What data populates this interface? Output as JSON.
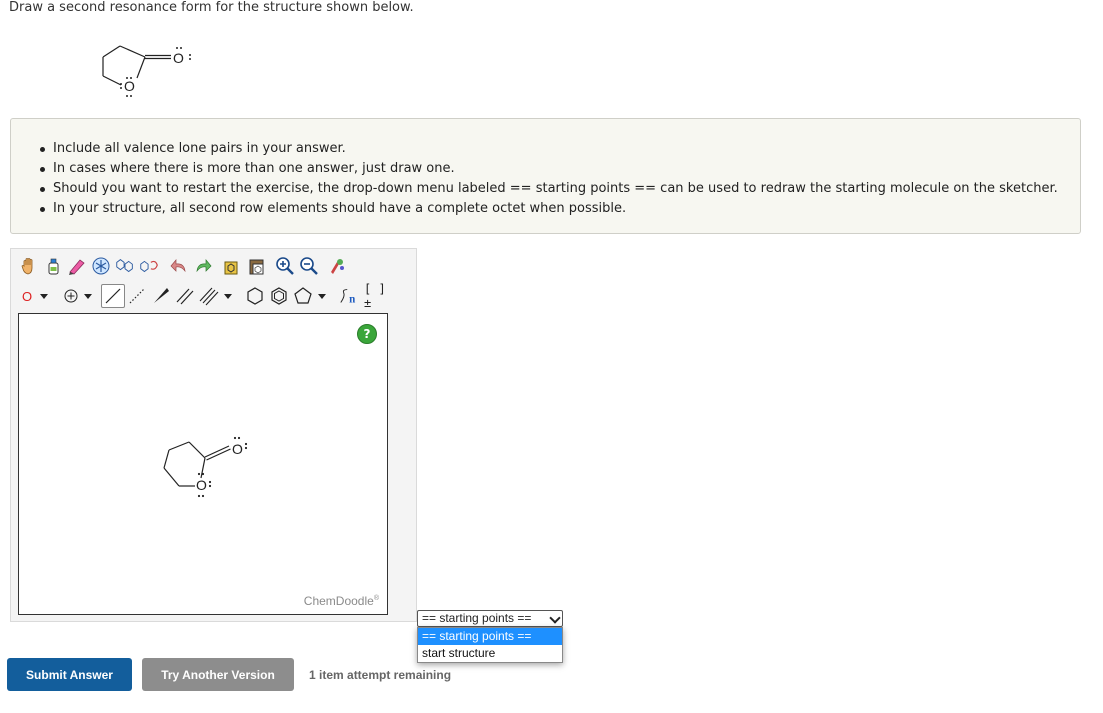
{
  "question": {
    "prompt": "Draw a second resonance form for the structure shown below."
  },
  "instructions": [
    "Include all valence lone pairs in your answer.",
    "In cases where there is more than one answer, just draw one.",
    "Should you want to restart the exercise, the drop-down menu labeled == starting points == can be used to redraw the starting molecule on the sketcher.",
    "In your structure, all second row elements should have a complete octet when possible."
  ],
  "molecule": {
    "atom_label": "O"
  },
  "sketcher": {
    "element_selector": "O",
    "help_label": "?",
    "brand": "ChemDoodle",
    "brand_mark": "®",
    "toolbar_row1": [
      "hand-icon",
      "eraser-bottle-icon",
      "pencil-icon",
      "atom-template-icon",
      "ring-template-icon",
      "ring-flip-icon",
      "undo-icon",
      "redo-icon",
      "copy-icon",
      "paste-icon",
      "zoom-in-icon",
      "zoom-out-icon",
      "clean-icon"
    ],
    "toolbar_row2": [
      "element-o-select",
      "charge-plus-icon",
      "single-bond-icon",
      "dashed-bond-icon",
      "wedge-bond-icon",
      "double-bond-icon",
      "triple-bond-icon",
      "hexagon-icon",
      "benzene-icon",
      "pentagon-icon",
      "sgroup-icon",
      "bracket-charge-icon"
    ],
    "sgroup_label": "n",
    "bracket_label": "[ ]±"
  },
  "dropdown": {
    "selected": "== starting points ==",
    "options": [
      "== starting points ==",
      "start structure"
    ]
  },
  "buttons": {
    "submit": "Submit Answer",
    "try_another": "Try Another Version"
  },
  "attempts": "1 item attempt remaining",
  "colors": {
    "submit": "#135e9c",
    "try_another": "#8d8d8d",
    "highlight": "#1e90ff",
    "help": "#3aa63a"
  }
}
